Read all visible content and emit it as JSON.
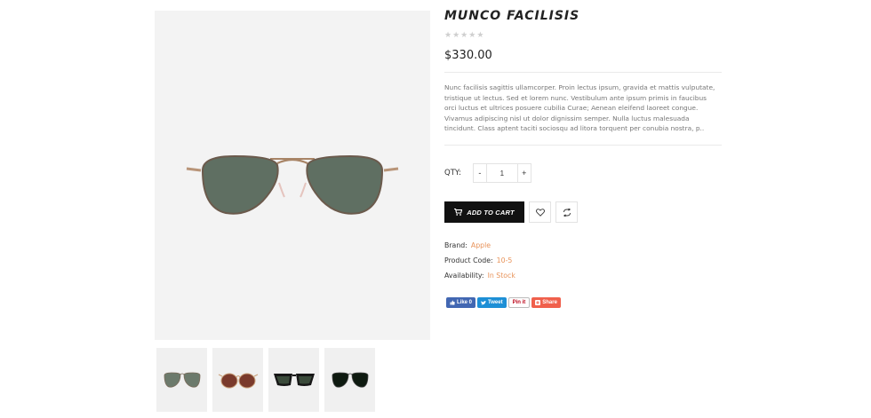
{
  "product": {
    "title": "MUNCO FACILISIS",
    "rating_stars": 0,
    "price": "$330.00",
    "description": "Nunc facilisis sagittis ullamcorper. Proin lectus ipsum, gravida et mattis vulputate, tristique ut lectus. Sed et lorem nunc. Vestibulum ante ipsum primis in faucibus orci luctus et ultrices posuere cubilia Curae; Aenean eleifend laoreet congue. Vivamus adipiscing nisl ut dolor dignissim semper. Nulla luctus malesuada tincidunt. Class aptent taciti sociosqu ad litora torquent per conubia nostra, p..",
    "qty_label": "QTY:",
    "qty_value": "1",
    "qty_minus": "-",
    "qty_plus": "+",
    "add_to_cart_label": "ADD TO CART",
    "brand_label": "Brand:",
    "brand_value": "Apple",
    "code_label": "Product Code:",
    "code_value": "10-5",
    "availability_label": "Availability:",
    "availability_value": "In Stock"
  },
  "share": {
    "facebook": "Like 0",
    "twitter": "Tweet",
    "pinterest": "Pin it",
    "share": "Share"
  },
  "thumbnails": [
    "green-aviator",
    "brown-round",
    "black-wayfarer",
    "black-aviator"
  ],
  "colors": {
    "accent": "#e8935a",
    "cart_button": "#111111"
  }
}
